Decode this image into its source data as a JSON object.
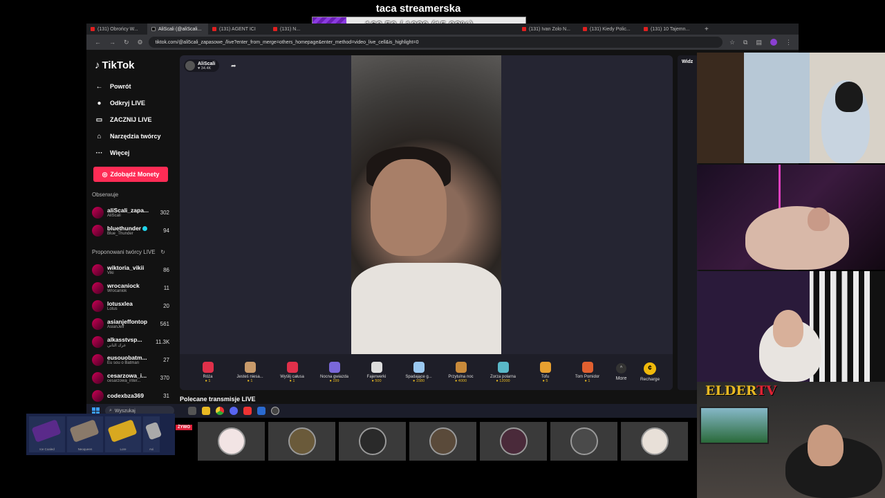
{
  "overlay": {
    "goal_title": "taca streamerska",
    "goal_text": "162.50 / 1020 (15.93%)",
    "goal_progress": 0.1593
  },
  "browser": {
    "tabs": [
      {
        "label": "(131) Obrońcy W..."
      },
      {
        "label": "AliScali (@aliScali..."
      },
      {
        "label": "(131) AGENT ICI"
      },
      {
        "label": "(131) N..."
      },
      {
        "label": "(131) Ivan Zolo N..."
      },
      {
        "label": "(131) Kiedy Polic..."
      },
      {
        "label": "(131) 10 Tajemn..."
      }
    ],
    "url": "tiktok.com/@ali5cali_zapasowe_/live?enter_from_merge=others_homepage&enter_method=video_live_cell&is_highlight=0",
    "profile_initial": "J"
  },
  "tiktok": {
    "logo": "TikTok",
    "nav": [
      {
        "label": "Powrót",
        "icon": "←"
      },
      {
        "label": "Odkryj LIVE",
        "icon": "●"
      },
      {
        "label": "ZACZNIJ LIVE",
        "icon": "▭"
      },
      {
        "label": "Narzędzia twórcy",
        "icon": "⌂"
      },
      {
        "label": "Więcej",
        "icon": "···"
      }
    ],
    "coins_button": "Zdobądź Monety",
    "following_title": "Obserwuje",
    "following": [
      {
        "name": "aliScali_zapa...",
        "sub": "AliScali",
        "count": "302"
      },
      {
        "name": "bluethunder",
        "sub": "Blue_Thunder",
        "count": "94"
      }
    ],
    "suggested_title": "Proponowani twórcy LIVE",
    "suggested": [
      {
        "name": "wiktoria_vikii",
        "sub": "Viki",
        "count": "86"
      },
      {
        "name": "wrocaniock",
        "sub": "Wrocaniok",
        "count": "11"
      },
      {
        "name": "lotusxlea",
        "sub": "Lotus",
        "count": "20"
      },
      {
        "name": "asianjeffontop",
        "sub": "AsianJeff",
        "count": "561"
      },
      {
        "name": "alkasstvsp...",
        "sub": "غرك الثاني",
        "count": "11.3K"
      },
      {
        "name": "eusouobatm...",
        "sub": "Eu sou o Batman",
        "count": "27"
      },
      {
        "name": "cesarzowa_i...",
        "sub": "cesarzowa_inter...",
        "count": "370"
      },
      {
        "name": "codexbza369",
        "sub": "",
        "count": "31"
      }
    ],
    "host": {
      "name": "AliScali",
      "likes": "34.4K"
    },
    "gifts": [
      {
        "name": "Róża",
        "price": "1",
        "color": "#e0304a"
      },
      {
        "name": "Jesteś niesa...",
        "price": "1",
        "color": "#c89a6a"
      },
      {
        "name": "Wyślij całusa",
        "price": "1",
        "color": "#e0304a"
      },
      {
        "name": "Nocna gwiazda",
        "price": "199",
        "color": "#7a68d8"
      },
      {
        "name": "Fajerwerki",
        "price": "500",
        "color": "#dddddd"
      },
      {
        "name": "Spadające g...",
        "price": "1580",
        "color": "#9ac8f0"
      },
      {
        "name": "Przytulna noc",
        "price": "4000",
        "color": "#c88a3a"
      },
      {
        "name": "Zorza polarna",
        "price": "12000",
        "color": "#5ab8c8"
      },
      {
        "name": "Tofu",
        "price": "5",
        "color": "#e8a030"
      },
      {
        "name": "Tom Pomidor",
        "price": "1",
        "color": "#e06030"
      }
    ],
    "more_label": "More",
    "recharge_label": "Recharge",
    "recommended_label": "Polecane transmisje LIVE",
    "right_panel_label": "Widz"
  },
  "taskbar": {
    "search_placeholder": "Wyszukaj"
  },
  "skins": [
    {
      "label": "Ice Coaled"
    },
    {
      "label": "Neoqueen"
    },
    {
      "label": "Lore"
    },
    {
      "label": "Asi"
    }
  ],
  "live_badge": "ŻYWO",
  "viewers": [
    {
      "color": "#f2e4e4"
    },
    {
      "color": "#6a5a3a"
    },
    {
      "color": "#2a2a2a"
    },
    {
      "color": "#5a4a3a"
    },
    {
      "color": "#4a2a3a"
    },
    {
      "color": "#4a4a4a"
    },
    {
      "color": "#e8e0d8"
    }
  ],
  "cams": {
    "elder_logo_prefix": "ELDER",
    "elder_logo_suffix": "TV"
  }
}
